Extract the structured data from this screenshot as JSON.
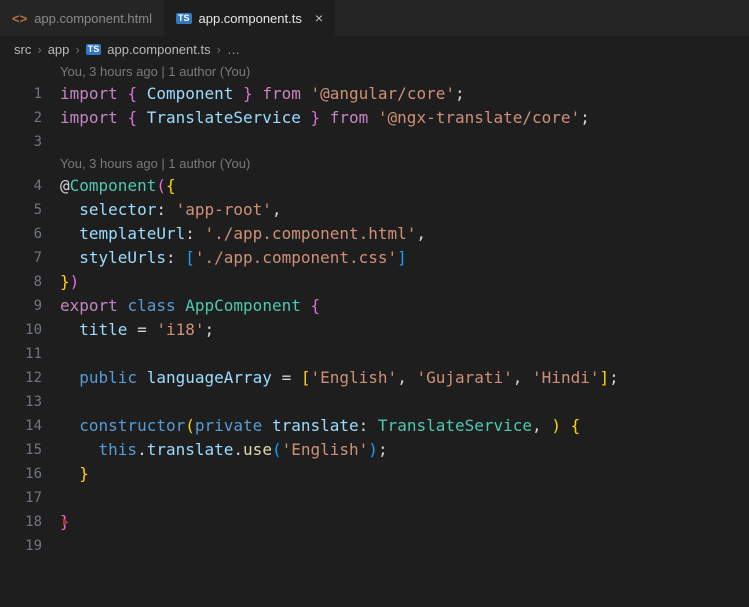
{
  "tabs": {
    "html": "app.component.html",
    "ts": "app.component.ts"
  },
  "breadcrumb": {
    "p0": "src",
    "p1": "app",
    "p2": "app.component.ts",
    "ellipsis": "…"
  },
  "codelens": {
    "l0": "You, 3 hours ago | 1 author (You)",
    "l1": "You, 3 hours ago | 1 author (You)"
  },
  "code": {
    "l1": {
      "import": "import",
      "lb": "{ ",
      "Component": "Component",
      "rb": " }",
      "from": "from",
      "str": "'@angular/core'",
      "semi": ";"
    },
    "l2": {
      "import": "import",
      "lb": "{ ",
      "TS": "TranslateService",
      "rb": " }",
      "from": "from",
      "str": "'@ngx-translate/core'",
      "semi": ";"
    },
    "l4": {
      "at": "@",
      "Component": "Component",
      "lp": "(",
      "lb": "{"
    },
    "l5": {
      "selector": "selector",
      "colon": ": ",
      "str": "'app-root'",
      "comma": ","
    },
    "l6": {
      "templateUrl": "templateUrl",
      "colon": ": ",
      "str": "'./app.component.html'",
      "comma": ","
    },
    "l7": {
      "styleUrls": "styleUrls",
      "colon": ": ",
      "lb": "[",
      "str": "'./app.component.css'",
      "rb": "]"
    },
    "l8": {
      "rb": "}",
      "rp": ")"
    },
    "l9": {
      "export": "export",
      "class": "class",
      "AppComponent": "AppComponent",
      "lb": "{"
    },
    "l10": {
      "title": "title",
      "eq": " = ",
      "str": "'i18'",
      "semi": ";"
    },
    "l12": {
      "public": "public",
      "var": "languageArray",
      "eq": " = ",
      "lb": "[",
      "s1": "'English'",
      "c": ", ",
      "s2": "'Gujarati'",
      "s3": "'Hindi'",
      "rb": "]",
      "semi": ";"
    },
    "l14": {
      "constructor": "constructor",
      "lp": "(",
      "private": "private",
      "translate": "translate",
      "colon": ": ",
      "TS": "TranslateService",
      "comma": ", ",
      "rp": ")",
      "lb": "{"
    },
    "l15": {
      "this": "this",
      "dot": ".",
      "translate": "translate",
      "use": "use",
      "lp": "(",
      "str": "'English'",
      "rp": ")",
      "semi": ";"
    },
    "l16": {
      "rb": "}"
    },
    "l18": {
      "rb": "}"
    }
  },
  "line_numbers": [
    "1",
    "2",
    "3",
    "4",
    "5",
    "6",
    "7",
    "8",
    "9",
    "10",
    "11",
    "12",
    "13",
    "14",
    "15",
    "16",
    "17",
    "18",
    "19"
  ]
}
